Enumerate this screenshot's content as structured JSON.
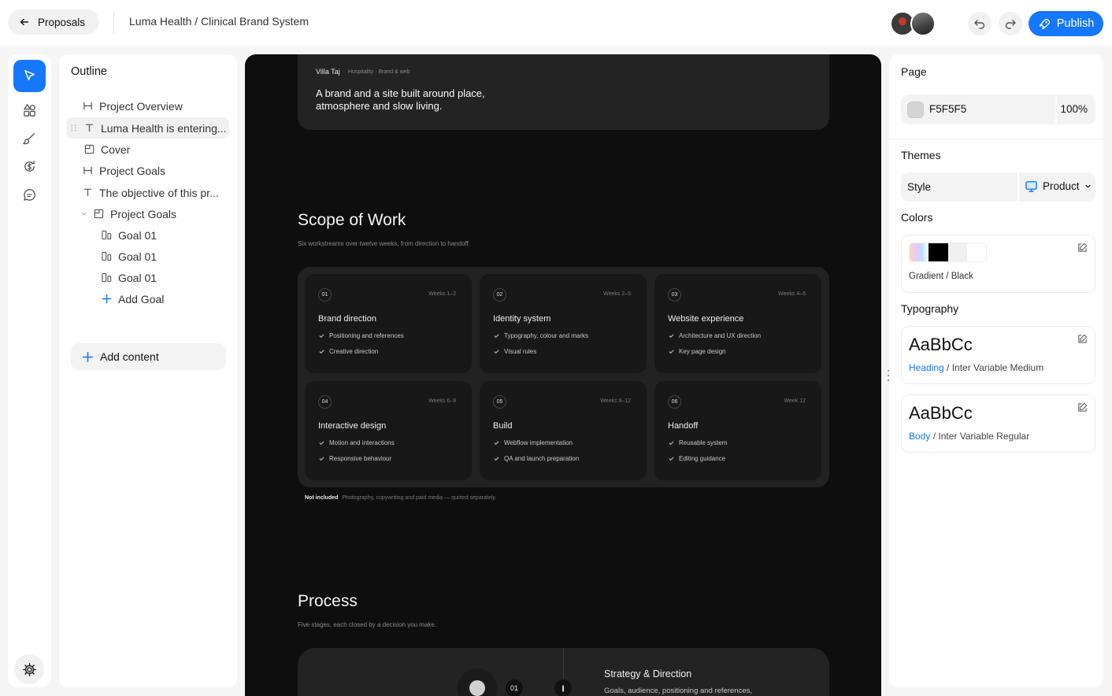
{
  "topbar": {
    "back_label": "Proposals",
    "title": "Luma Health / Clinical Brand System",
    "publish_label": "Publish"
  },
  "outline": {
    "title": "Outline",
    "items": [
      {
        "icon": "heading-icon",
        "label": "Project Overview"
      },
      {
        "icon": "text-icon",
        "label": "Luma Health is entering..."
      },
      {
        "icon": "cover-icon",
        "label": "Cover"
      },
      {
        "icon": "heading-icon",
        "label": "Project Goals"
      },
      {
        "icon": "text-icon",
        "label": "The objective of this pr..."
      },
      {
        "icon": "section-icon",
        "label": "Project Goals"
      },
      {
        "icon": "goal-icon",
        "label": "Goal 01"
      },
      {
        "icon": "goal-icon",
        "label": "Goal 01"
      },
      {
        "icon": "goal-icon",
        "label": "Goal 01"
      },
      {
        "icon": "plus-icon",
        "label": "Add Goal"
      }
    ],
    "add_content_label": "Add content"
  },
  "canvas": {
    "villa": {
      "name": "Villa Taj",
      "meta": "Hospitality · Brand & web",
      "description": "A brand and a site built around place, atmosphere and slow living."
    },
    "scope": {
      "title": "Scope of Work",
      "subtitle": "Six workstreams over twelve weeks, from direction to handoff.",
      "cards": [
        {
          "num": "01",
          "weeks": "Weeks 1–2",
          "title": "Brand direction",
          "items": [
            "Positioning and references",
            "Creative direction"
          ]
        },
        {
          "num": "02",
          "weeks": "Weeks 2–5",
          "title": "Identity system",
          "items": [
            "Typography, colour and marks",
            "Visual rules"
          ]
        },
        {
          "num": "03",
          "weeks": "Weeks 4–6",
          "title": "Website experience",
          "items": [
            "Architecture and UX direction",
            "Key page design"
          ]
        },
        {
          "num": "04",
          "weeks": "Weeks 6–9",
          "title": "Interactive design",
          "items": [
            "Motion and interactions",
            "Responsive behaviour"
          ]
        },
        {
          "num": "05",
          "weeks": "Weeks 9–12",
          "title": "Build",
          "items": [
            "Webflow implementation",
            "QA and launch preparation"
          ]
        },
        {
          "num": "06",
          "weeks": "Week 12",
          "title": "Handoff",
          "items": [
            "Reusable system",
            "Editing guidance"
          ]
        }
      ],
      "not_included_label": "Not included",
      "not_included_text": "Photography, copywriting and paid media — quoted separately."
    },
    "process": {
      "title": "Process",
      "subtitle": "Five stages, each closed by a decision you make.",
      "step_num": "01",
      "step_title": "Strategy & Direction",
      "step_desc": "Goals, audience, positioning and references,"
    }
  },
  "props": {
    "page_label": "Page",
    "page_color": "F5F5F5",
    "page_opacity": "100%",
    "themes_label": "Themes",
    "style_label": "Style",
    "style_value": "Product",
    "colors_label": "Colors",
    "colors_name": "Gradient / Black",
    "typography_label": "Typography",
    "heading_sample": "AaBbCc",
    "heading_role": "Heading",
    "heading_font": " / Inter Variable Medium",
    "body_sample": "AaBbCc",
    "body_role": "Body",
    "body_font": " / Inter Variable Regular"
  },
  "colors": {
    "accent": "#1677ff",
    "canvas_bg": "#0e0e0e",
    "page_swatch": "#F5F5F5"
  }
}
